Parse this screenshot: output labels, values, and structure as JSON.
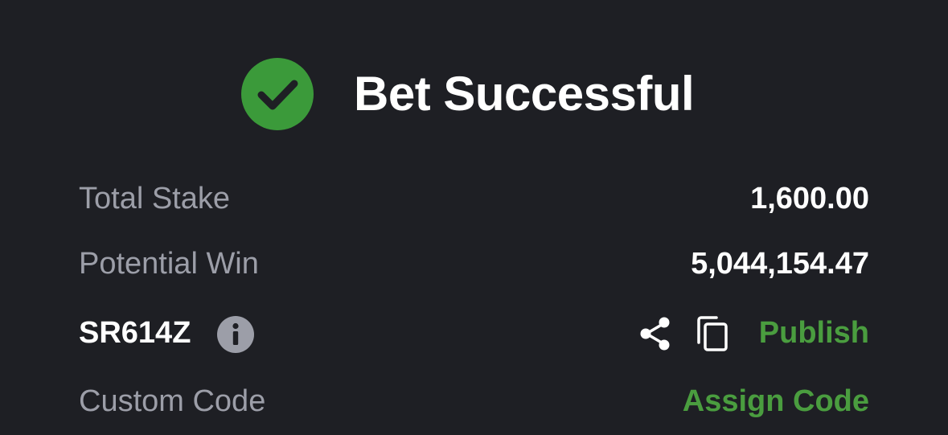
{
  "header": {
    "title": "Bet Successful",
    "icon": "check-circle-icon",
    "icon_color": "#3b9a3a"
  },
  "summary": {
    "total_stake_label": "Total Stake",
    "total_stake_value": "1,600.00",
    "potential_win_label": "Potential Win",
    "potential_win_value": "5,044,154.47",
    "booking_code": "SR614Z",
    "publish_label": "Publish",
    "custom_code_label": "Custom Code",
    "assign_code_label": "Assign Code"
  },
  "icons": {
    "info": "info-icon",
    "share": "share-icon",
    "copy": "copy-icon"
  },
  "colors": {
    "background": "#1e1f24",
    "accent_green": "#4a9d3f",
    "label_gray": "#9c9ea8",
    "text_white": "#ffffff"
  }
}
